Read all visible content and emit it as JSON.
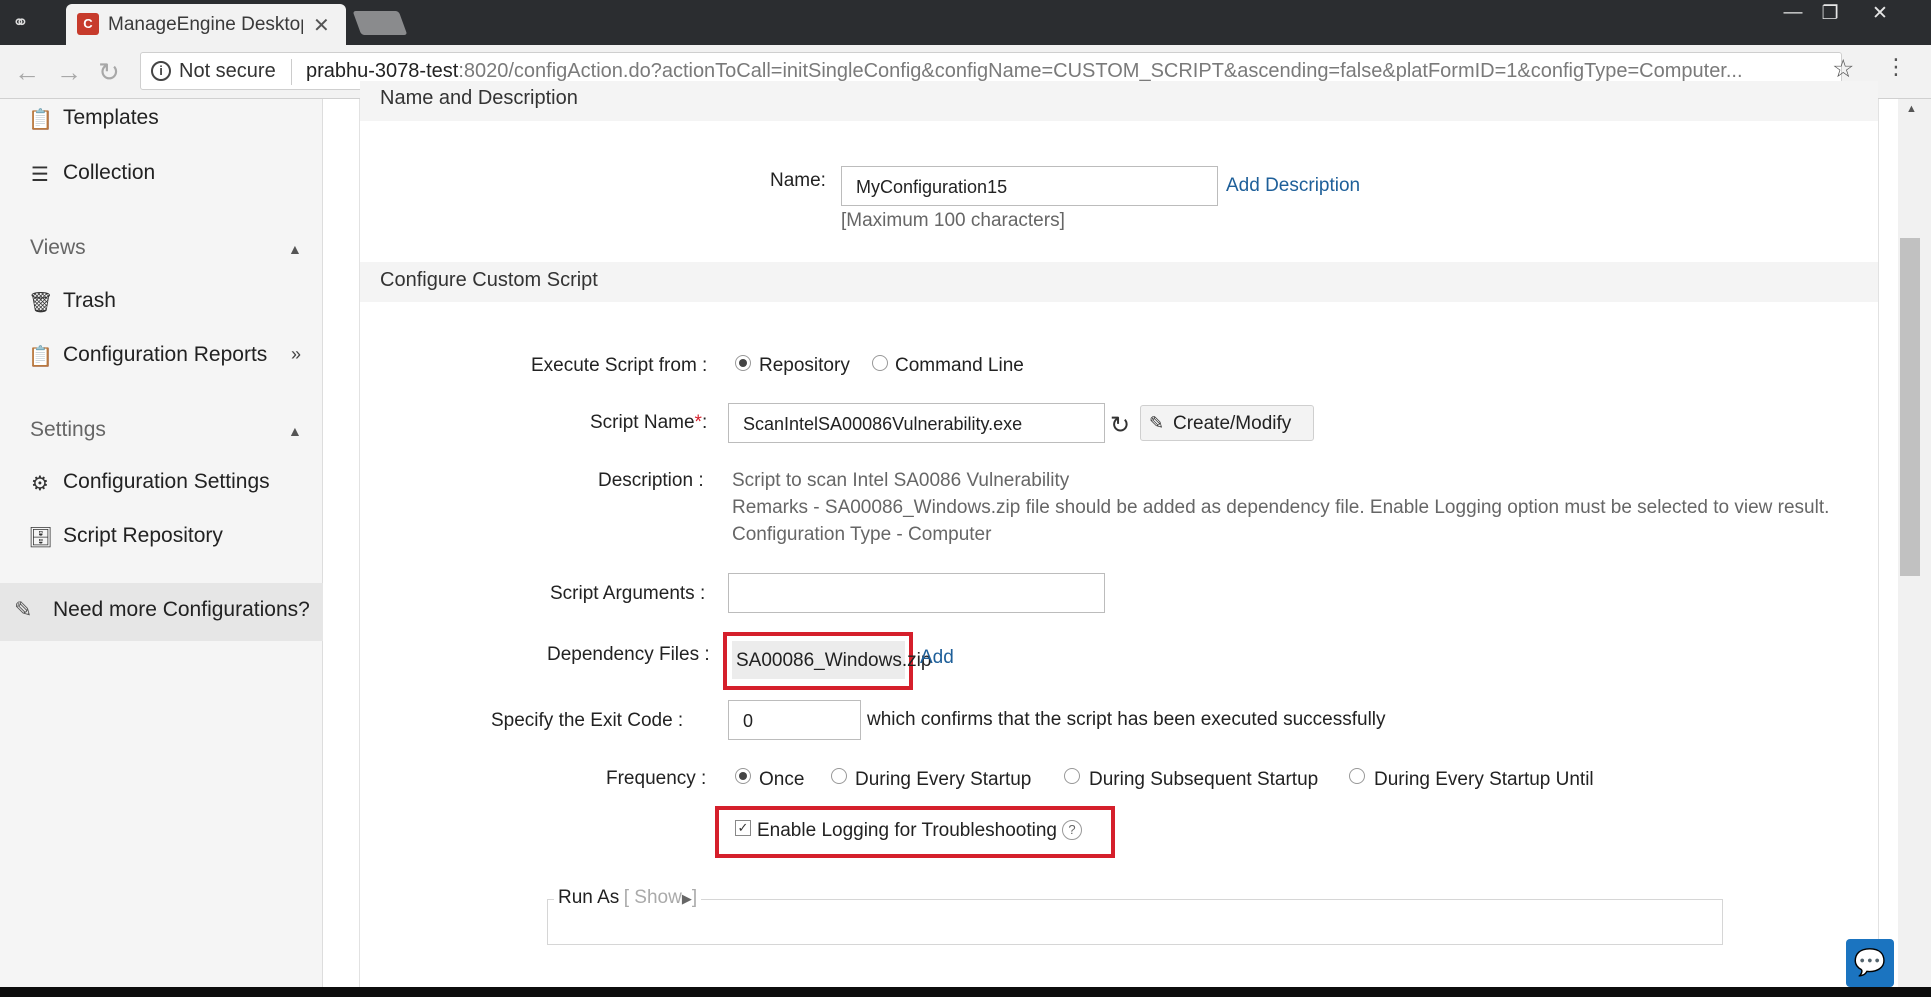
{
  "browser": {
    "tab_title": "ManageEngine Desktop C",
    "not_secure": "Not secure",
    "url_host": "prabhu-3078-test",
    "url_rest": ":8020/configAction.do?actionToCall=initSingleConfig&configName=CUSTOM_SCRIPT&ascending=false&platFormID=1&configType=Computer..."
  },
  "sidebar": {
    "items_top": [
      {
        "label": "Templates",
        "icon": "clipboard-icon"
      },
      {
        "label": "Collection",
        "icon": "layers-icon"
      }
    ],
    "views_header": "Views",
    "views_items": [
      {
        "label": "Trash",
        "icon": "trash-icon"
      },
      {
        "label": "Configuration Reports",
        "icon": "report-icon"
      }
    ],
    "settings_header": "Settings",
    "settings_items": [
      {
        "label": "Configuration Settings",
        "icon": "gear-stack-icon"
      },
      {
        "label": "Script Repository",
        "icon": "script-box-icon"
      }
    ],
    "need_more": "Need more Configurations?"
  },
  "form": {
    "name_section": "Name and Description",
    "name_label": "Name:",
    "name_value": "MyConfiguration15",
    "add_description": "Add Description",
    "max_chars": "[Maximum 100 characters]",
    "custom_section": "Configure Custom Script",
    "exec_label": "Execute Script from :",
    "exec_opt_repo": "Repository",
    "exec_opt_cmd": "Command Line",
    "script_name_label": "Script Name",
    "script_name_req": "*",
    "script_name_colon": ":",
    "script_name_value": "ScanIntelSA00086Vulnerability.exe",
    "create_modify": "Create/Modify",
    "desc_label": "Description :",
    "desc_line1": "Script to scan Intel SA0086 Vulnerability",
    "desc_line2": "Remarks - SA00086_Windows.zip file should be added as dependency file. Enable Logging option must be selected to view result.",
    "desc_line3": "Configuration Type - Computer",
    "args_label": "Script Arguments :",
    "args_value": "",
    "dep_label": "Dependency Files :",
    "dep_file": "SA00086_Windows.zip",
    "dep_add": "Add",
    "exit_label": "Specify the Exit Code :",
    "exit_value": "0",
    "exit_note": "which confirms that the script has been executed successfully",
    "freq_label": "Frequency :",
    "freq_once": "Once",
    "freq_every": "During Every Startup",
    "freq_subsequent": "During Subsequent Startup",
    "freq_until": "During Every Startup Until",
    "logging_label": "Enable Logging for Troubleshooting",
    "help": "?",
    "run_as": "Run As",
    "show": "[ Show",
    "show_end": "]"
  },
  "colors": {
    "accent_link": "#1e5f99",
    "highlight": "#d51f2b"
  }
}
